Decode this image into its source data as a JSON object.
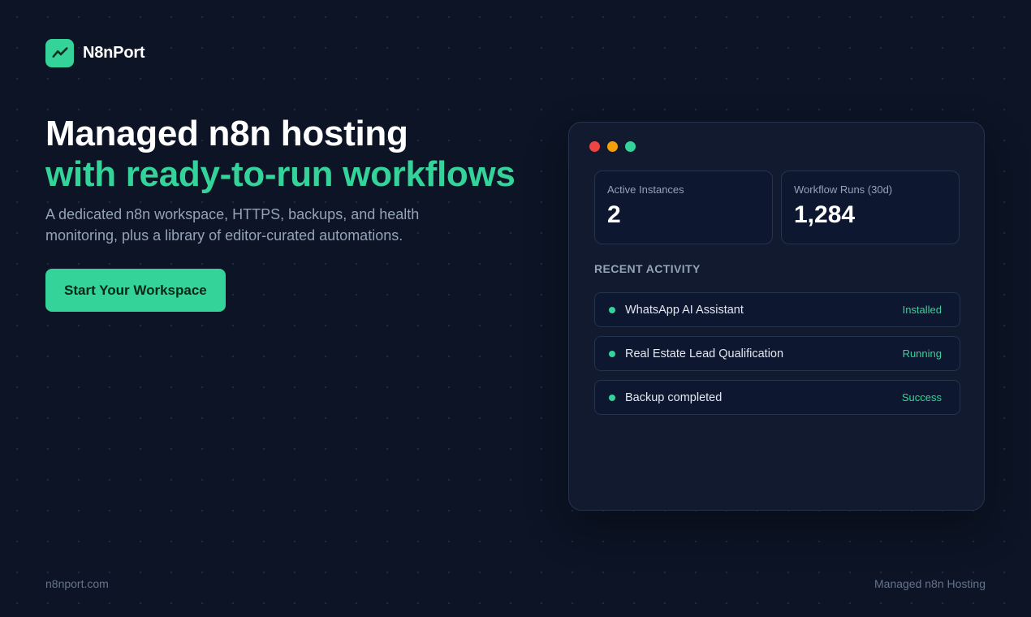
{
  "brand": {
    "name": "N8nPort",
    "logo_icon": "trend-line-icon",
    "accent": "#34d399"
  },
  "hero": {
    "title_line1": "Managed n8n hosting",
    "title_line2": "with ready-to-run workflows",
    "subtitle": "A dedicated n8n workspace, HTTPS, backups, and health monitoring, plus a library of editor-curated automations.",
    "cta_label": "Start Your Workspace"
  },
  "dashboard": {
    "window_dots": [
      "#ef4444",
      "#f59e0b",
      "#34d399"
    ],
    "stats": [
      {
        "label": "Active Instances",
        "value": "2"
      },
      {
        "label": "Workflow Runs (30d)",
        "value": "1,284"
      }
    ],
    "activity_title": "RECENT ACTIVITY",
    "activity": [
      {
        "name": "WhatsApp AI Assistant",
        "status": "Installed"
      },
      {
        "name": "Real Estate Lead Qualification",
        "status": "Running"
      },
      {
        "name": "Backup completed",
        "status": "Success"
      }
    ]
  },
  "footer": {
    "left": "n8nport.com",
    "right": "Managed n8n Hosting"
  }
}
